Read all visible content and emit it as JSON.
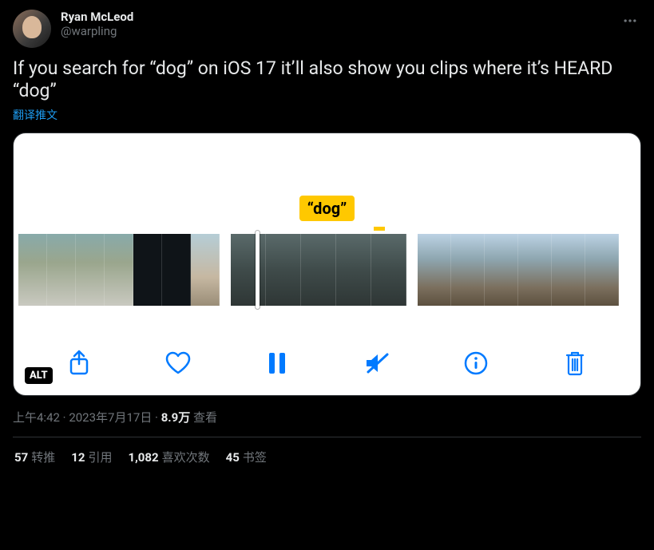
{
  "author": {
    "display_name": "Ryan McLeod",
    "handle": "@warpling"
  },
  "tweet_text": "If you search for “dog” on iOS 17 it’ll also show you clips where it’s HEARD “dog”",
  "translate_label": "翻译推文",
  "media": {
    "bubble_text": "“dog”",
    "alt_badge": "ALT"
  },
  "meta": {
    "time": "上午4:42",
    "date": "2023年7月17日",
    "views_count": "8.9万",
    "views_label": "查看"
  },
  "stats": {
    "retweets_count": "57",
    "retweets_label": "转推",
    "quotes_count": "12",
    "quotes_label": "引用",
    "likes_count": "1,082",
    "likes_label": "喜欢次数",
    "bookmarks_count": "45",
    "bookmarks_label": "书签"
  }
}
